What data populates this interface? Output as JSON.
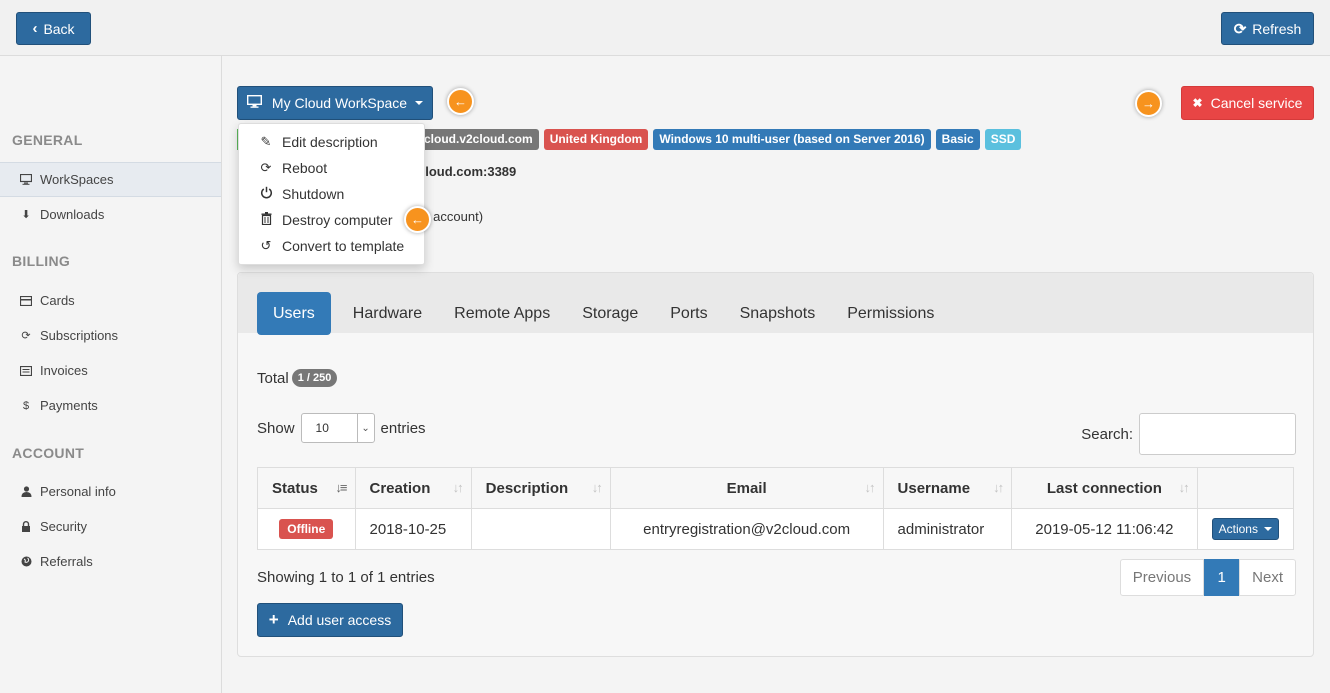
{
  "topbar": {
    "back_label": "Back",
    "refresh_label": "Refresh"
  },
  "sidebar": {
    "sections": [
      {
        "title": "GENERAL",
        "items": [
          {
            "label": "WorkSpaces",
            "icon": "monitor-icon",
            "active": true
          },
          {
            "label": "Downloads",
            "icon": "download-icon"
          }
        ]
      },
      {
        "title": "BILLING",
        "items": [
          {
            "label": "Cards",
            "icon": "credit-card-icon"
          },
          {
            "label": "Subscriptions",
            "icon": "refresh-icon"
          },
          {
            "label": "Invoices",
            "icon": "list-icon"
          },
          {
            "label": "Payments",
            "icon": "dollar-icon"
          }
        ]
      },
      {
        "title": "ACCOUNT",
        "items": [
          {
            "label": "Personal info",
            "icon": "user-icon"
          },
          {
            "label": "Security",
            "icon": "lock-icon"
          },
          {
            "label": "Referrals",
            "icon": "globe-icon"
          }
        ]
      }
    ]
  },
  "workspace": {
    "button_label": "My Cloud WorkSpace",
    "cancel_label": "Cancel service",
    "labels": {
      "host": "cloud.v2cloud.com",
      "region": "United Kingdom",
      "os": "Windows 10 multi-user (based on Server 2016)",
      "plan": "Basic",
      "disk": "SSD"
    },
    "rdp_text": "cloud.com:3389",
    "account_text": "ur account)"
  },
  "dropdown": {
    "items": [
      {
        "label": "Edit description",
        "icon": "pencil-icon"
      },
      {
        "label": "Reboot",
        "icon": "reboot-icon"
      },
      {
        "label": "Shutdown",
        "icon": "power-icon"
      },
      {
        "label": "Destroy computer",
        "icon": "trash-icon"
      },
      {
        "label": "Convert to template",
        "icon": "convert-icon"
      }
    ]
  },
  "tabs": [
    "Users",
    "Hardware",
    "Remote Apps",
    "Storage",
    "Ports",
    "Snapshots",
    "Permissions"
  ],
  "users": {
    "total_label": "Total",
    "total_badge": "1 / 250",
    "show_label": "Show",
    "entries_value": "10",
    "entries_label": "entries",
    "search_label": "Search:",
    "columns": [
      "Status",
      "Creation",
      "Description",
      "Email",
      "Username",
      "Last connection"
    ],
    "rows": [
      {
        "status": "Offline",
        "creation": "2018-10-25",
        "description": "",
        "email": "entryregistration@v2cloud.com",
        "username": "administrator",
        "last_connection": "2019-05-12 11:06:42",
        "action": "Actions"
      }
    ],
    "showing_text": "Showing 1 to 1 of 1 entries",
    "pager": {
      "prev": "Previous",
      "page": "1",
      "next": "Next"
    },
    "add_label": "Add user access"
  },
  "colors": {
    "primary": "#2d6a9f",
    "danger": "#e84545",
    "pointer": "#f7931e",
    "tab_active": "#337ab7"
  }
}
